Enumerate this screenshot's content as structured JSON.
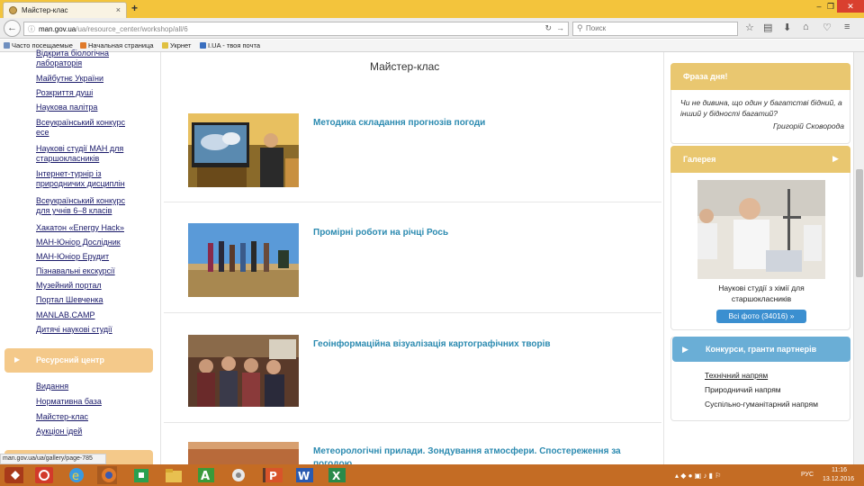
{
  "browser": {
    "tab_title": "Майстер-клас",
    "tab_close": "×",
    "new_tab": "+",
    "url_host": "man.gov.ua",
    "url_path": "/ua/resource_center/workshop/all/6",
    "search_placeholder": "Поиск",
    "window_buttons": [
      "–",
      "❐",
      "✕"
    ]
  },
  "bookmarks": [
    {
      "label": "Часто посещаемые",
      "icon_color": "#6f8fbf"
    },
    {
      "label": "Начальная страница",
      "icon_color": "#e07a2a"
    },
    {
      "label": "Укрнет",
      "icon_color": "#e0c040"
    },
    {
      "label": "I.UA - твоя почта",
      "icon_color": "#3a6fbf"
    }
  ],
  "sidebar": {
    "links": [
      "Відкрита біологічна лабораторія",
      "Майбутнє України",
      "Розкриття душі",
      "Наукова палітра",
      "Всеукраїнський конкурс есе",
      "Наукові студії МАН для старшокласників",
      "Інтернет-турнір із природничих дисциплін",
      "Всеукраїнський конкурс для учнів 6–8 класів",
      "Хакатон «Energy Hack»",
      "МАН-Юніор Дослідник",
      "МАН-Юніор Ерудит",
      "Пізнавальні екскурсії",
      "Музейний портал",
      "Портал Шевченка",
      "MANLAB.CAMP",
      "Дитячі наукові студії"
    ],
    "section_label": "Ресурсний центр",
    "sub_links": [
      "Видання",
      "Нормативна база",
      "Майстер-клас",
      "Аукціон ідей"
    ]
  },
  "main": {
    "title": "Майстер-клас",
    "articles": [
      {
        "title": "Методика складання прогнозів погоди"
      },
      {
        "title": "Промірні роботи на річці Рось"
      },
      {
        "title": "Геоінформаційна візуалізація картографічних творів"
      },
      {
        "title": "Метеорологічні прилади. Зондування атмосфери. Спостереження за погодою"
      }
    ]
  },
  "right": {
    "phrase_header": "Фраза дня!",
    "quote": "Чи не дивина, що один у багатстві бідний, а інший у бідності багатий?",
    "quote_author": "Григорій Сковорода",
    "gallery_header": "Галерея",
    "gallery_caption": "Наукові студії з хімії для старшокласників",
    "all_photos": "Всі фото (34016) »",
    "partners_header": "Конкурси, гранти партнерів",
    "partners": [
      "Технічний напрям",
      "Природничий напрям",
      "Суспільно-гуманітарний напрям"
    ]
  },
  "status_bar": "man.gov.ua/ua/gallery/page-785",
  "taskbar": {
    "time": "11:16",
    "date": "13.12.2016",
    "lang": "РУС"
  },
  "colors": {
    "titlebar": "#f3c43c",
    "accent_orange": "#f4c98a",
    "accent_yellow": "#e9c770",
    "accent_blue": "#6aaed6",
    "link_teal": "#2b8ab0",
    "taskbar": "#c46c24"
  }
}
